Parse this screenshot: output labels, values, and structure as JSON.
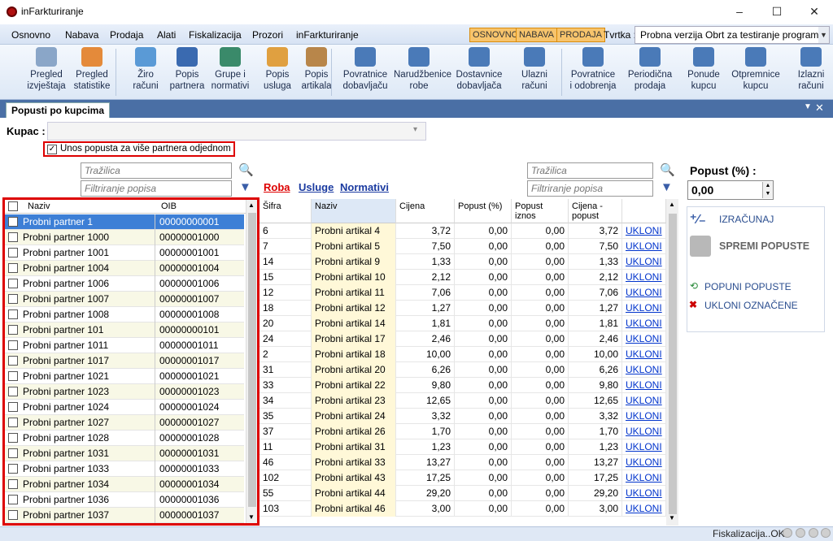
{
  "window": {
    "title": "inFarkturiranje",
    "minimize": "–",
    "maximize": "☐",
    "close": "✕"
  },
  "menu": [
    "Osnovno",
    "Nabava",
    "Prodaja",
    "Alati",
    "Fiskalizacija",
    "Prozori",
    "inFarkturiranje"
  ],
  "modes": [
    "OSNOVNO",
    "NABAVA",
    "PRODAJA"
  ],
  "tvrtka": {
    "label": "Tvrtka :",
    "value": "Probna verzija Obrt za testiranje programa"
  },
  "ribbon": [
    {
      "l1": "Pregled",
      "l2": "izvještaja",
      "color": "#8aa6c8"
    },
    {
      "l1": "Pregled",
      "l2": "statistike",
      "color": "#e48a3a"
    },
    {
      "l1": "Žiro",
      "l2": "računi",
      "color": "#5a9ad6"
    },
    {
      "l1": "Popis",
      "l2": "partnera",
      "color": "#3a6ab0"
    },
    {
      "l1": "Grupe i",
      "l2": "normativi",
      "color": "#3a8a6a"
    },
    {
      "l1": "Popis",
      "l2": "usluga",
      "color": "#e0a040"
    },
    {
      "l1": "Popis",
      "l2": "artikala",
      "color": "#b8864a"
    },
    {
      "l1": "Povratnice",
      "l2": "dobavljaču",
      "color": "#4a7ab8"
    },
    {
      "l1": "Narudžbenice",
      "l2": "robe",
      "color": "#4a7ab8"
    },
    {
      "l1": "Dostavnice",
      "l2": "dobavljača",
      "color": "#4a7ab8"
    },
    {
      "l1": "Ulazni",
      "l2": "računi",
      "color": "#4a7ab8"
    },
    {
      "l1": "Povratnice",
      "l2": "i odobrenja",
      "color": "#4a7ab8"
    },
    {
      "l1": "Periodična",
      "l2": "prodaja",
      "color": "#4a7ab8"
    },
    {
      "l1": "Ponude",
      "l2": "kupcu",
      "color": "#4a7ab8"
    },
    {
      "l1": "Otpremnice",
      "l2": "kupcu",
      "color": "#4a7ab8"
    },
    {
      "l1": "Izlazni",
      "l2": "računi",
      "color": "#4a7ab8"
    }
  ],
  "tab": {
    "label": "Popusti po kupcima",
    "close": "✕",
    "menu": "▼"
  },
  "kupac": {
    "label": "Kupac :",
    "value": "",
    "arrow": "▾"
  },
  "multi": {
    "label": "Unos popusta za više partnera odjednom",
    "checked": "✓"
  },
  "left_search": {
    "trazilica": "Tražilica",
    "filter": "Filtriranje popisa"
  },
  "right_search": {
    "trazilica": "Tražilica",
    "filter": "Filtriranje popisa"
  },
  "left_list": {
    "headers": [
      "Naziv",
      "OIB"
    ],
    "rows": [
      [
        "Probni partner 1",
        "00000000001"
      ],
      [
        "Probni partner 1000",
        "00000001000"
      ],
      [
        "Probni partner 1001",
        "00000001001"
      ],
      [
        "Probni partner 1004",
        "00000001004"
      ],
      [
        "Probni partner 1006",
        "00000001006"
      ],
      [
        "Probni partner 1007",
        "00000001007"
      ],
      [
        "Probni partner 1008",
        "00000001008"
      ],
      [
        "Probni partner 101",
        "00000000101"
      ],
      [
        "Probni partner 1011",
        "00000001011"
      ],
      [
        "Probni partner 1017",
        "00000001017"
      ],
      [
        "Probni partner 1021",
        "00000001021"
      ],
      [
        "Probni partner 1023",
        "00000001023"
      ],
      [
        "Probni partner 1024",
        "00000001024"
      ],
      [
        "Probni partner 1027",
        "00000001027"
      ],
      [
        "Probni partner 1028",
        "00000001028"
      ],
      [
        "Probni partner 1031",
        "00000001031"
      ],
      [
        "Probni partner 1033",
        "00000001033"
      ],
      [
        "Probni partner 1034",
        "00000001034"
      ],
      [
        "Probni partner 1036",
        "00000001036"
      ],
      [
        "Probni partner 1037",
        "00000001037"
      ]
    ]
  },
  "subtabs": [
    "Roba",
    "Usluge",
    "Normativi"
  ],
  "grid": {
    "headers": [
      "Šifra",
      "Naziv",
      "Cijena",
      "Popust (%)",
      "Popust iznos",
      "Cijena - popust",
      ""
    ],
    "action": "UKLONI",
    "rows": [
      [
        "6",
        "Probni artikal 4",
        "3,72",
        "0,00",
        "0,00",
        "3,72"
      ],
      [
        "7",
        "Probni artikal 5",
        "7,50",
        "0,00",
        "0,00",
        "7,50"
      ],
      [
        "14",
        "Probni artikal 9",
        "1,33",
        "0,00",
        "0,00",
        "1,33"
      ],
      [
        "15",
        "Probni artikal 10",
        "2,12",
        "0,00",
        "0,00",
        "2,12"
      ],
      [
        "12",
        "Probni artikal 11",
        "7,06",
        "0,00",
        "0,00",
        "7,06"
      ],
      [
        "18",
        "Probni artikal 12",
        "1,27",
        "0,00",
        "0,00",
        "1,27"
      ],
      [
        "20",
        "Probni artikal 14",
        "1,81",
        "0,00",
        "0,00",
        "1,81"
      ],
      [
        "24",
        "Probni artikal 17",
        "2,46",
        "0,00",
        "0,00",
        "2,46"
      ],
      [
        "2",
        "Probni artikal 18",
        "10,00",
        "0,00",
        "0,00",
        "10,00"
      ],
      [
        "31",
        "Probni artikal 20",
        "6,26",
        "0,00",
        "0,00",
        "6,26"
      ],
      [
        "33",
        "Probni artikal 22",
        "9,80",
        "0,00",
        "0,00",
        "9,80"
      ],
      [
        "34",
        "Probni artikal 23",
        "12,65",
        "0,00",
        "0,00",
        "12,65"
      ],
      [
        "35",
        "Probni artikal 24",
        "3,32",
        "0,00",
        "0,00",
        "3,32"
      ],
      [
        "37",
        "Probni artikal 26",
        "1,70",
        "0,00",
        "0,00",
        "1,70"
      ],
      [
        "11",
        "Probni artikal 31",
        "1,23",
        "0,00",
        "0,00",
        "1,23"
      ],
      [
        "46",
        "Probni artikal 33",
        "13,27",
        "0,00",
        "0,00",
        "13,27"
      ],
      [
        "102",
        "Probni artikal 43",
        "17,25",
        "0,00",
        "0,00",
        "17,25"
      ],
      [
        "55",
        "Probni artikal 44",
        "29,20",
        "0,00",
        "0,00",
        "29,20"
      ],
      [
        "103",
        "Probni artikal 46",
        "3,00",
        "0,00",
        "0,00",
        "3,00"
      ]
    ]
  },
  "popust": {
    "title": "Popust (%) :",
    "value": "0,00"
  },
  "actions": {
    "izracunaj": "IZRAČUNAJ",
    "spremi": "SPREMI POPUSTE",
    "popuni": "POPUNI POPUSTE",
    "ukloni": "UKLONI OZNAČENE"
  },
  "status": {
    "text": "Fiskalizacija..OK"
  }
}
